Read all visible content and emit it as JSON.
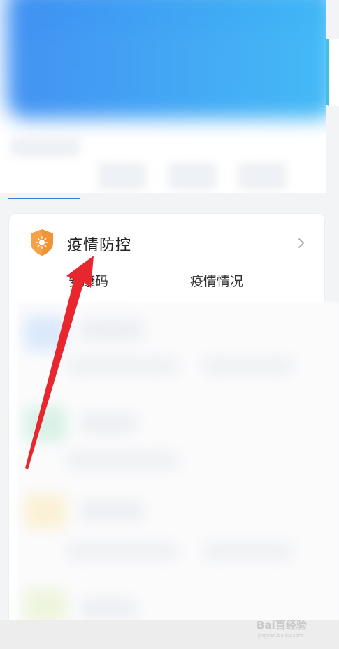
{
  "epidemic_card": {
    "title": "疫情防控",
    "items": [
      {
        "label": "安康码"
      },
      {
        "label": "疫情情况"
      }
    ]
  },
  "watermark": {
    "brand": "Bai百经验",
    "url": "jingyan.baidu.com"
  },
  "colors": {
    "accent": "#3a7bd5",
    "shield": "#f4a248",
    "arrow": "#e8262e"
  }
}
